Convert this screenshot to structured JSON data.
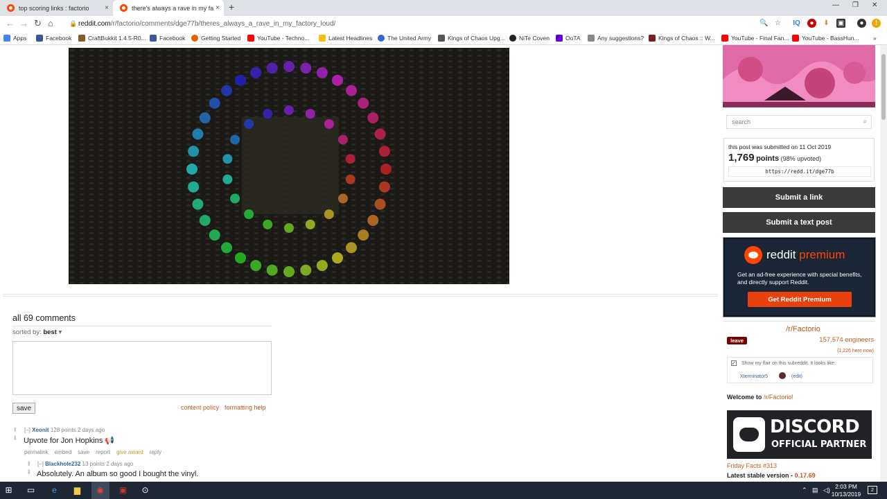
{
  "browser": {
    "tabs": [
      {
        "label": "top scoring links : factorio",
        "close": "×"
      },
      {
        "label": "there's always a rave in my factory",
        "close": "×"
      }
    ],
    "new_tab": "+",
    "url_host": "reddit.com",
    "url_path": "/r/factorio/comments/dge77b/theres_always_a_rave_in_my_factory_loud/",
    "bookmarks": [
      {
        "label": "Apps",
        "color": "#4285f4"
      },
      {
        "label": "Facebook",
        "color": "#3b5998"
      },
      {
        "label": "CraftBukkit 1.4.5-R0...",
        "color": "#8b5a2b"
      },
      {
        "label": "Facebook",
        "color": "#3b5998"
      },
      {
        "label": "Getting Started",
        "color": "#e66000"
      },
      {
        "label": "YouTube - Techno...",
        "color": "#ff0000"
      },
      {
        "label": "Latest Headlines",
        "color": "#f4c20d"
      },
      {
        "label": "The United Army",
        "color": "#3367d6"
      },
      {
        "label": "Kings of Chaos Upg...",
        "color": "#555555"
      },
      {
        "label": "NiTe Coven",
        "color": "#222222"
      },
      {
        "label": "OoTA",
        "color": "#6001d2"
      },
      {
        "label": "Any suggestions?",
        "color": "#888888"
      },
      {
        "label": "Kings of Chaos :: W...",
        "color": "#7a1e1e"
      },
      {
        "label": "YouTube - Final Fan...",
        "color": "#ff0000"
      },
      {
        "label": "YouTube - BassHun...",
        "color": "#ff0000"
      }
    ],
    "more": "»"
  },
  "comments_section": {
    "title": "all 69 comments",
    "sorted_by_label": "sorted by:",
    "sorted_by_value": "best",
    "save_label": "save",
    "content_policy": "content policy",
    "formatting_help": "formatting help"
  },
  "comments": [
    {
      "collapse": "[–]",
      "author": "Xeonit",
      "meta": "128 points 2 days ago",
      "body": "Upvote for Jon Hopkins",
      "emoji": "📢",
      "actions": [
        "permalink",
        "embed",
        "save",
        "report",
        "give award",
        "reply"
      ]
    },
    {
      "collapse": "[–]",
      "author": "Blackhole232",
      "meta": "13 points 2 days ago",
      "body": "Absolutely. An album so good I bought the vinyl."
    }
  ],
  "sidebar": {
    "search_placeholder": "search",
    "submitted_text": "this post was submitted on 11 Oct 2019",
    "points": "1,769",
    "points_word": "points",
    "upvoted": "(98% upvoted)",
    "shortlink": "https://redd.it/dge77b",
    "submit_link": "Submit a link",
    "submit_text": "Submit a text post",
    "premium": {
      "brand": "reddit",
      "brand_accent": "premium",
      "description": "Get an ad-free experience with special benefits, and directly support Reddit.",
      "button": "Get Reddit Premium"
    },
    "subreddit": {
      "name": "/r/Factorio",
      "leave": "leave",
      "members": "157,574 engineers",
      "online": "(1,226 here now)",
      "flair_label": "Show my flair on this subreddit. It looks like:",
      "flair_user": "Xterminator5",
      "flair_edit": "(edit)",
      "welcome_prefix": "Welcome to",
      "welcome_link": "/r/Factorio!",
      "discord_line1": "DISCORD",
      "discord_line2": "OFFICIAL PARTNER",
      "friday_facts": "Friday Facts #313",
      "latest_label": "Latest stable version -",
      "latest_value": "0.17.69"
    }
  },
  "taskbar": {
    "time": "2:03 PM",
    "date": "10/13/2019",
    "notifications": "2"
  },
  "colors": {
    "link_orange": "#c45a1e",
    "author_blue": "#336699",
    "reddit_orange": "#ff4500",
    "taskbar": "#1e2733"
  }
}
